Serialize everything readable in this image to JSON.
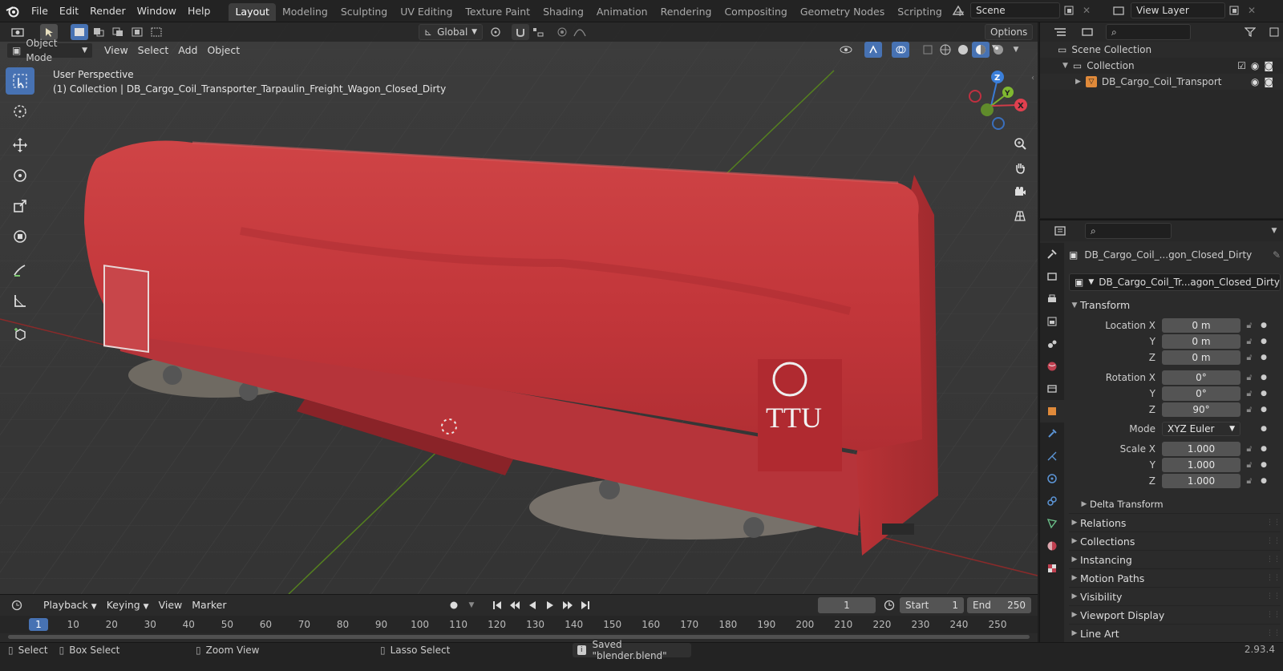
{
  "top_menu": {
    "items": [
      "File",
      "Edit",
      "Render",
      "Window",
      "Help"
    ]
  },
  "workspaces": {
    "tabs": [
      "Layout",
      "Modeling",
      "Sculpting",
      "UV Editing",
      "Texture Paint",
      "Shading",
      "Animation",
      "Rendering",
      "Compositing",
      "Geometry Nodes",
      "Scripting"
    ],
    "active": "Layout",
    "add_label": "+"
  },
  "scene": {
    "name": "Scene",
    "view_layer": "View Layer"
  },
  "viewport": {
    "transform_orientation": "Global",
    "options_label": "Options",
    "mode": "Object Mode",
    "menus": [
      "View",
      "Select",
      "Add",
      "Object"
    ],
    "perspective_text": "User Perspective",
    "collection_text": "(1) Collection | DB_Cargo_Coil_Transporter_Tarpaulin_Freight_Wagon_Closed_Dirty",
    "gizmo": {
      "z": "Z",
      "y": "Y",
      "x": "X"
    },
    "wagon_logo_text": "TTU",
    "colors": {
      "tarp": "#c9373a",
      "floor": "#393939",
      "x_axis": "#a03030",
      "y_axis": "#5d8a24"
    }
  },
  "timeline": {
    "menus": [
      "Playback",
      "Keying",
      "View",
      "Marker"
    ],
    "current_frame": "1",
    "start_label": "Start",
    "start_value": "1",
    "end_label": "End",
    "end_value": "250",
    "ticks": [
      "1",
      "10",
      "20",
      "30",
      "40",
      "50",
      "60",
      "70",
      "80",
      "90",
      "100",
      "110",
      "120",
      "130",
      "140",
      "150",
      "160",
      "170",
      "180",
      "190",
      "200",
      "210",
      "220",
      "230",
      "240",
      "250"
    ]
  },
  "status": {
    "select_label": "Select",
    "box_select_label": "Box Select",
    "zoom_label": "Zoom View",
    "lasso_label": "Lasso Select",
    "message": "Saved \"blender.blend\"",
    "version": "2.93.4"
  },
  "outliner": {
    "scene_collection": "Scene Collection",
    "collection": "Collection",
    "object": "DB_Cargo_Coil_Transport"
  },
  "properties": {
    "object_name_header": "DB_Cargo_Coil_...gon_Closed_Dirty",
    "object_name_field": "DB_Cargo_Coil_Tr...agon_Closed_Dirty",
    "transform_title": "Transform",
    "location": {
      "label_x": "Location X",
      "label_y": "Y",
      "label_z": "Z",
      "x": "0 m",
      "y": "0 m",
      "z": "0 m"
    },
    "rotation": {
      "label_x": "Rotation X",
      "label_y": "Y",
      "label_z": "Z",
      "x": "0°",
      "y": "0°",
      "z": "90°"
    },
    "mode_label": "Mode",
    "mode_value": "XYZ Euler",
    "scale": {
      "label_x": "Scale X",
      "label_y": "Y",
      "label_z": "Z",
      "x": "1.000",
      "y": "1.000",
      "z": "1.000"
    },
    "delta_transform": "Delta Transform",
    "panels": [
      "Relations",
      "Collections",
      "Instancing",
      "Motion Paths",
      "Visibility",
      "Viewport Display",
      "Line Art"
    ]
  }
}
